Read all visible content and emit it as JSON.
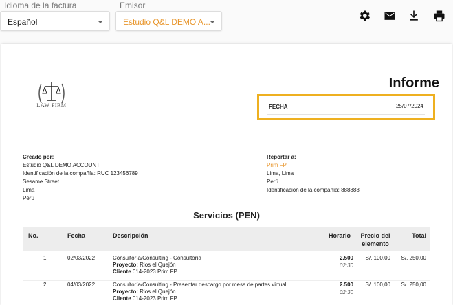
{
  "toolbar": {
    "language_label": "Idioma de la factura",
    "language_value": "Español",
    "issuer_label": "Emisor",
    "issuer_value": "Estudio Q&L DEMO A...",
    "icons": [
      "gear-icon",
      "mail-icon",
      "download-icon",
      "print-icon"
    ]
  },
  "document": {
    "logo_text": "LAW FIRM",
    "title": "Informe",
    "date_label": "FECHA",
    "date_value": "25/07/2024",
    "created_by": {
      "heading": "Creado por:",
      "lines": [
        "Estudio Q&L DEMO ACCOUNT",
        "Identificación de la compañía: RUC 123456789",
        "Sesame Street",
        "Lima",
        "Perú"
      ]
    },
    "report_to": {
      "heading": "Reportar a:",
      "name": "Prim FP",
      "lines": [
        "Lima, Lima",
        "Perú",
        "Identificación de la compañía: 888888"
      ]
    },
    "section_title": "Servicios (PEN)",
    "table": {
      "headers": [
        "No.",
        "Fecha",
        "Descripción",
        "Horario",
        "Precio del elemento",
        "Total"
      ],
      "rows": [
        {
          "no": "1",
          "date": "02/03/2022",
          "desc": "Consultoría/Consulting - Consultoría",
          "project_label": "Proyecto:",
          "project_value": "Rios el Quejón",
          "client_label": "Cliente",
          "client_value": "014-2023  Prim FP",
          "hours": "2.500",
          "time": "02:30",
          "price": "S/. 100,00",
          "total": "S/. 250,00"
        },
        {
          "no": "2",
          "date": "04/03/2022",
          "desc": "Consultoría/Consulting - Presentar descargo por mesa de partes virtual",
          "project_label": "Proyecto:",
          "project_value": "Rios el Quejón",
          "client_label": "Cliente",
          "client_value": "014-2023  Prim FP",
          "hours": "2.500",
          "time": "02:30",
          "price": "S/. 100,00",
          "total": "S/. 250,00"
        }
      ]
    }
  },
  "colors": {
    "accent": "#e8962c",
    "highlight_border": "#eeb020",
    "header_bg": "#ededed"
  }
}
